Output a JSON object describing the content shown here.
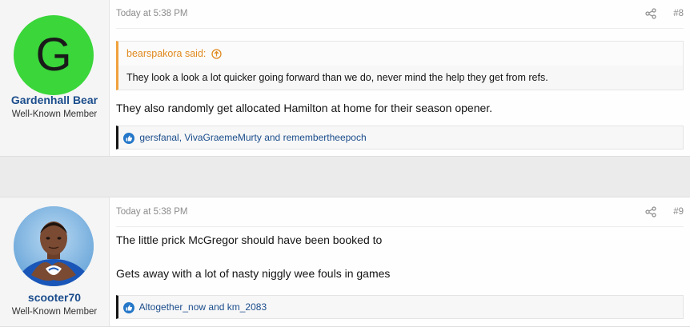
{
  "posts": [
    {
      "id": "post-8",
      "avatar_letter": "G",
      "avatar_color": "#3ad63a",
      "username": "Gardenhall Bear",
      "user_title": "Well-Known Member",
      "date": "Today at 5:38 PM",
      "post_number": "#8",
      "quote": {
        "author_label": "bearspakora said:",
        "text": "They look a look a lot quicker going forward than we do, never mind the help they get from refs."
      },
      "message": "They also randomly get allocated Hamilton at home for their season opener.",
      "reactions": {
        "users": [
          "gersfanal",
          "VivaGraemeMurty",
          "remembertheepoch"
        ],
        "sep1": ", ",
        "sep2": " and "
      }
    },
    {
      "id": "post-9",
      "username": "scooter70",
      "user_title": "Well-Known Member",
      "date": "Today at 5:38 PM",
      "post_number": "#9",
      "message_lines": [
        "The little prick McGregor should have been booked to",
        "Gets away with a lot of nasty niggly wee fouls in games"
      ],
      "reactions": {
        "users": [
          "Altogether_now",
          "km_2083"
        ],
        "sep1": " and "
      }
    }
  ],
  "colors": {
    "accent_link": "#1b4d8c",
    "quote_accent": "#e08a1f",
    "like_blue": "#2577c8"
  }
}
